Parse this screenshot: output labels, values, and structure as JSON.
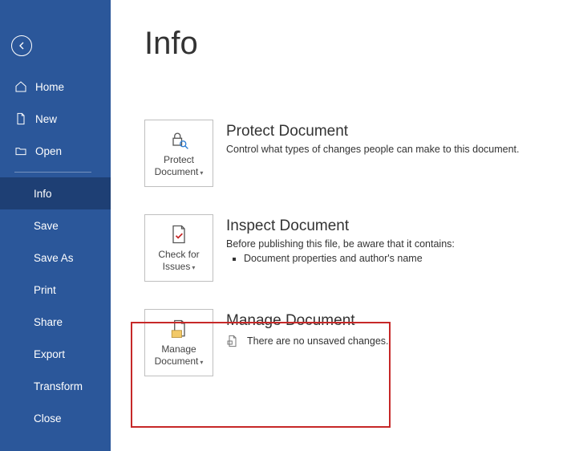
{
  "sidebar": {
    "items": [
      {
        "label": "Home",
        "icon": "home"
      },
      {
        "label": "New",
        "icon": "file"
      },
      {
        "label": "Open",
        "icon": "folder"
      }
    ],
    "items2": [
      {
        "label": "Info"
      },
      {
        "label": "Save"
      },
      {
        "label": "Save As"
      },
      {
        "label": "Print"
      },
      {
        "label": "Share"
      },
      {
        "label": "Export"
      },
      {
        "label": "Transform"
      },
      {
        "label": "Close"
      }
    ]
  },
  "page": {
    "title": "Info"
  },
  "protect": {
    "button": "Protect Document",
    "title": "Protect Document",
    "desc": "Control what types of changes people can make to this document."
  },
  "inspect": {
    "button": "Check for Issues",
    "title": "Inspect Document",
    "desc": "Before publishing this file, be aware that it contains:",
    "item1": "Document properties and author's name"
  },
  "manage": {
    "button": "Manage Document",
    "title": "Manage Document",
    "desc": "There are no unsaved changes."
  }
}
